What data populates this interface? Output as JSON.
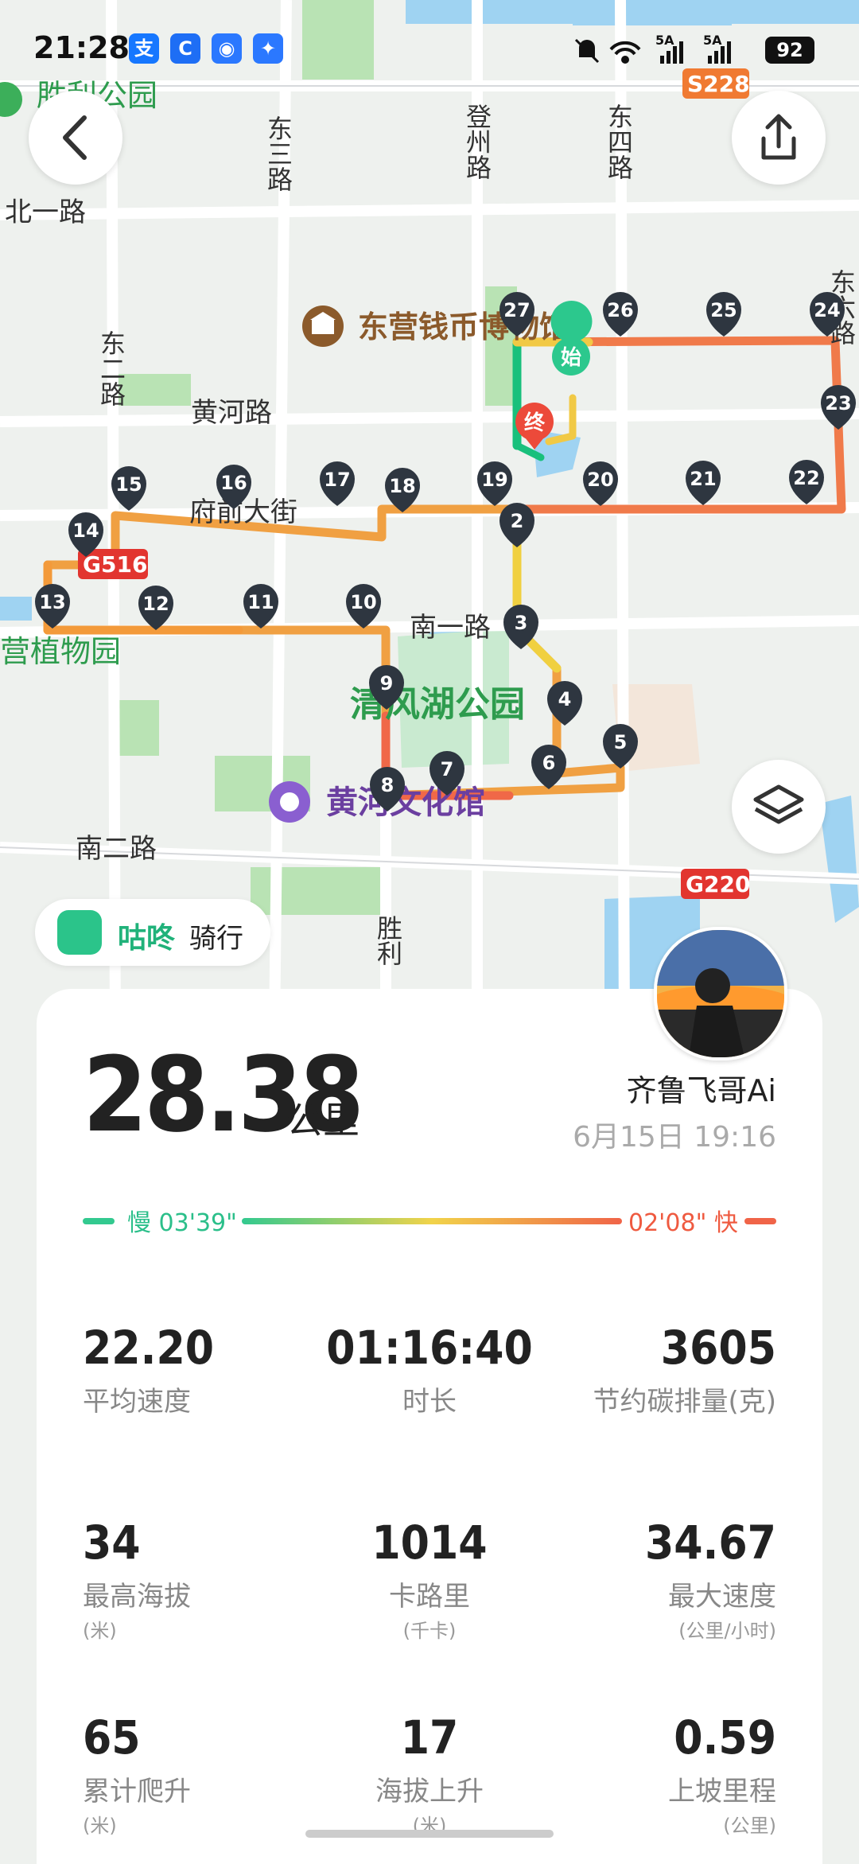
{
  "status_bar": {
    "time": "21:28",
    "signal_a": "5A",
    "signal_b": "5A",
    "battery": "92"
  },
  "map": {
    "labels": {
      "shengli_park": "胜利公园",
      "north1_road": "北一路",
      "dong3": "东三路",
      "dengzhou": "登州路",
      "dong4": "东四路",
      "dong2": "东二路",
      "huanghe_road": "黄河路",
      "fuqian": "府前大街",
      "nan1": "南一路",
      "nan2": "南二路",
      "shengli_road": "胜利",
      "dong6": "东六路",
      "botanic": "营植物园",
      "qingfenghu": "清风湖公园",
      "coin_museum": "东营钱币博物馆",
      "culture_center": "黄河文化馆",
      "highway_g516": "G516",
      "highway_s228": "S228",
      "highway_g220": "G220",
      "start_label": "始",
      "end_label": "终"
    },
    "markers": [
      "2",
      "3",
      "4",
      "5",
      "6",
      "7",
      "8",
      "9",
      "10",
      "11",
      "12",
      "13",
      "14",
      "15",
      "16",
      "17",
      "18",
      "19",
      "20",
      "21",
      "22",
      "23",
      "24",
      "25",
      "26",
      "27"
    ]
  },
  "brand": {
    "name": "咕咚",
    "mode": "骑行"
  },
  "summary": {
    "distance": "28.38",
    "distance_unit": "公里",
    "user": "齐鲁飞哥Ai",
    "datetime": "6月15日 19:16",
    "pace_slow": "慢 03'39\"",
    "pace_fast": "02'08\" 快"
  },
  "stats": [
    {
      "value": "22.20",
      "label": "平均速度",
      "unit": ""
    },
    {
      "value": "01:16:40",
      "label": "时长",
      "unit": ""
    },
    {
      "value": "3605",
      "label": "节约碳排量(克)",
      "unit": ""
    },
    {
      "value": "34",
      "label": "最高海拔",
      "unit": "(米)"
    },
    {
      "value": "1014",
      "label": "卡路里",
      "unit": "(千卡)"
    },
    {
      "value": "34.67",
      "label": "最大速度",
      "unit": "(公里/小时)"
    },
    {
      "value": "65",
      "label": "累计爬升",
      "unit": "(米)"
    },
    {
      "value": "17",
      "label": "海拔上升",
      "unit": "(米)"
    },
    {
      "value": "0.59",
      "label": "上坡里程",
      "unit": "(公里)"
    }
  ]
}
